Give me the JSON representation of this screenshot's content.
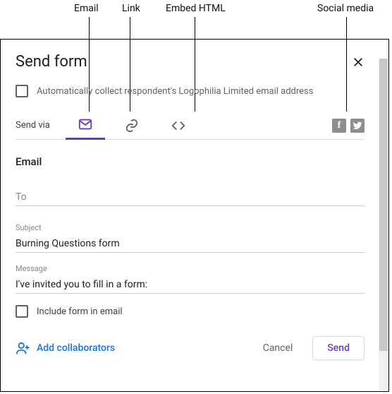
{
  "annotations": {
    "email": "Email",
    "link": "Link",
    "embed": "Embed HTML",
    "social": "Social media"
  },
  "dialog": {
    "title": "Send form",
    "collect_label": "Automatically collect respondent's Logophilia Limited email address",
    "send_via_label": "Send via",
    "section_title": "Email",
    "to_label": "To",
    "to_value": "",
    "subject_label": "Subject",
    "subject_value": "Burning Questions form",
    "message_label": "Message",
    "message_value": "I've invited you to fill in a form:",
    "include_label": "Include form in email",
    "add_collaborators": "Add collaborators",
    "cancel": "Cancel",
    "send": "Send"
  }
}
